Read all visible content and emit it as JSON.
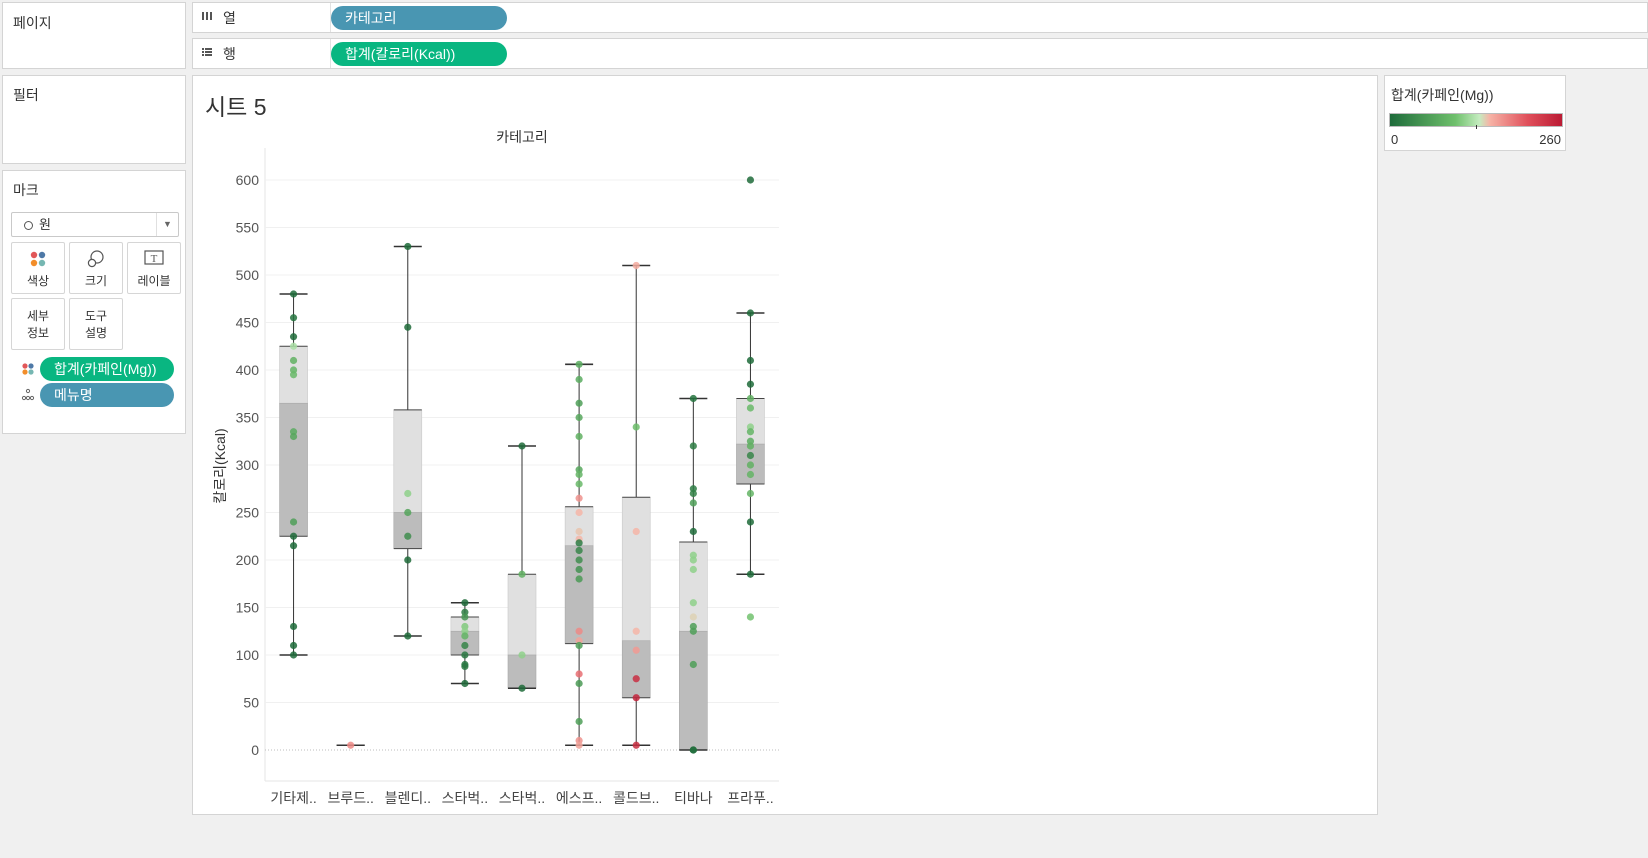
{
  "pages_card": {
    "title": "페이지"
  },
  "columns_shelf": {
    "label": "열",
    "icon": "columns-icon",
    "pill": "카테고리"
  },
  "rows_shelf": {
    "label": "행",
    "icon": "rows-icon",
    "pill": "합계(칼로리(Kcal))"
  },
  "filters_card": {
    "title": "필터"
  },
  "marks_card": {
    "title": "마크",
    "mark_type": "원",
    "buttons": {
      "color": "색상",
      "size": "크기",
      "label": "레이블",
      "detail_1": "세부",
      "detail_2": "정보",
      "tooltip_1": "도구",
      "tooltip_2": "설명"
    },
    "pills": {
      "color_pill": "합계(카페인(Mg))",
      "detail_pill": "메뉴명"
    }
  },
  "legend": {
    "title": "합계(카페인(Mg))",
    "min": "0",
    "max": "260"
  },
  "sheet": {
    "title": "시트 5"
  },
  "chart_data": {
    "type": "scatter",
    "subtype": "box-and-whisker with jittered points",
    "header": "카테고리",
    "ylabel": "칼로리(Kcal)",
    "ylim": [
      0,
      620
    ],
    "yticks": [
      0,
      50,
      100,
      150,
      200,
      250,
      300,
      350,
      400,
      450,
      500,
      550,
      600
    ],
    "grid": true,
    "color_measure": "합계(카페인(Mg))",
    "color_range": [
      0,
      260
    ],
    "colors": {
      "low": "#1e6b3a",
      "mid_low": "#8fd18b",
      "mid_high": "#f2a191",
      "high": "#bb1b34",
      "box_upper": "#e0e0e0",
      "box_lower": "#bcbcbc",
      "whisker": "#333333"
    },
    "categories": [
      "기타제..",
      "브루드..",
      "블렌디..",
      "스타벅..",
      "스타벅..",
      "에스프..",
      "콜드브..",
      "티바나",
      "프라푸.."
    ],
    "boxes": [
      {
        "category": "기타제..",
        "whisker_low": 100,
        "q1": 225,
        "median": 365,
        "q3": 425,
        "whisker_high": 480
      },
      {
        "category": "브루드..",
        "whisker_low": 5,
        "q1": 5,
        "median": 5,
        "q3": 5,
        "whisker_high": 5
      },
      {
        "category": "블렌디..",
        "whisker_low": 120,
        "q1": 212,
        "median": 250,
        "q3": 358,
        "whisker_high": 530
      },
      {
        "category": "스타벅..",
        "whisker_low": 70,
        "q1": 100,
        "median": 125,
        "q3": 140,
        "whisker_high": 155
      },
      {
        "category": "스타벅..",
        "whisker_low": 65,
        "q1": 65,
        "median": 100,
        "q3": 185,
        "whisker_high": 320
      },
      {
        "category": "에스프..",
        "whisker_low": 5,
        "q1": 112,
        "median": 215,
        "q3": 256,
        "whisker_high": 406
      },
      {
        "category": "콜드브..",
        "whisker_low": 5,
        "q1": 55,
        "median": 115,
        "q3": 266,
        "whisker_high": 510
      },
      {
        "category": "티바나",
        "whisker_low": 0,
        "q1": 0,
        "median": 125,
        "q3": 219,
        "whisker_high": 370
      },
      {
        "category": "프라푸..",
        "whisker_low": 185,
        "q1": 280,
        "median": 322,
        "q3": 370,
        "whisker_high": 460
      }
    ],
    "points": [
      {
        "category": "기타제..",
        "values": [
          {
            "y": 480,
            "c": 0
          },
          {
            "y": 455,
            "c": 10
          },
          {
            "y": 435,
            "c": 0
          },
          {
            "y": 425,
            "c": 120
          },
          {
            "y": 410,
            "c": 80
          },
          {
            "y": 400,
            "c": 85
          },
          {
            "y": 395,
            "c": 90
          },
          {
            "y": 335,
            "c": 75
          },
          {
            "y": 330,
            "c": 70
          },
          {
            "y": 240,
            "c": 60
          },
          {
            "y": 225,
            "c": 0
          },
          {
            "y": 215,
            "c": 0
          },
          {
            "y": 130,
            "c": 0
          },
          {
            "y": 110,
            "c": 0
          },
          {
            "y": 100,
            "c": 0
          }
        ]
      },
      {
        "category": "브루드..",
        "values": [
          {
            "y": 5,
            "c": 175
          }
        ]
      },
      {
        "category": "블렌디..",
        "values": [
          {
            "y": 530,
            "c": 0
          },
          {
            "y": 445,
            "c": 0
          },
          {
            "y": 270,
            "c": 110
          },
          {
            "y": 250,
            "c": 65
          },
          {
            "y": 225,
            "c": 40
          },
          {
            "y": 200,
            "c": 0
          },
          {
            "y": 120,
            "c": 0
          }
        ]
      },
      {
        "category": "스타벅..",
        "values": [
          {
            "y": 155,
            "c": 0
          },
          {
            "y": 145,
            "c": 20
          },
          {
            "y": 140,
            "c": 50
          },
          {
            "y": 130,
            "c": 105
          },
          {
            "y": 125,
            "c": 110
          },
          {
            "y": 120,
            "c": 85
          },
          {
            "y": 110,
            "c": 30
          },
          {
            "y": 100,
            "c": 15
          },
          {
            "y": 90,
            "c": 10
          },
          {
            "y": 88,
            "c": 15
          },
          {
            "y": 70,
            "c": 0
          }
        ]
      },
      {
        "category": "스타벅..",
        "values": [
          {
            "y": 320,
            "c": 0
          },
          {
            "y": 185,
            "c": 80
          },
          {
            "y": 100,
            "c": 110
          },
          {
            "y": 65,
            "c": 0
          }
        ]
      },
      {
        "category": "에스프..",
        "values": [
          {
            "y": 406,
            "c": 75
          },
          {
            "y": 390,
            "c": 75
          },
          {
            "y": 365,
            "c": 60
          },
          {
            "y": 350,
            "c": 70
          },
          {
            "y": 330,
            "c": 80
          },
          {
            "y": 295,
            "c": 70
          },
          {
            "y": 290,
            "c": 85
          },
          {
            "y": 280,
            "c": 90
          },
          {
            "y": 265,
            "c": 170
          },
          {
            "y": 250,
            "c": 150
          },
          {
            "y": 230,
            "c": 145
          },
          {
            "y": 222,
            "c": 150
          },
          {
            "y": 218,
            "c": 20
          },
          {
            "y": 210,
            "c": 30
          },
          {
            "y": 200,
            "c": 40
          },
          {
            "y": 190,
            "c": 45
          },
          {
            "y": 180,
            "c": 55
          },
          {
            "y": 125,
            "c": 175
          },
          {
            "y": 115,
            "c": 160
          },
          {
            "y": 110,
            "c": 60
          },
          {
            "y": 80,
            "c": 190
          },
          {
            "y": 70,
            "c": 55
          },
          {
            "y": 30,
            "c": 60
          },
          {
            "y": 10,
            "c": 170
          },
          {
            "y": 5,
            "c": 160
          }
        ]
      },
      {
        "category": "콜드브..",
        "values": [
          {
            "y": 510,
            "c": 155
          },
          {
            "y": 340,
            "c": 95
          },
          {
            "y": 230,
            "c": 150
          },
          {
            "y": 125,
            "c": 150
          },
          {
            "y": 105,
            "c": 165
          },
          {
            "y": 75,
            "c": 240
          },
          {
            "y": 55,
            "c": 250
          },
          {
            "y": 5,
            "c": 240
          }
        ]
      },
      {
        "category": "티바나",
        "values": [
          {
            "y": 370,
            "c": 10
          },
          {
            "y": 320,
            "c": 20
          },
          {
            "y": 275,
            "c": 20
          },
          {
            "y": 270,
            "c": 25
          },
          {
            "y": 260,
            "c": 60
          },
          {
            "y": 230,
            "c": 0
          },
          {
            "y": 205,
            "c": 110
          },
          {
            "y": 200,
            "c": 110
          },
          {
            "y": 190,
            "c": 110
          },
          {
            "y": 155,
            "c": 110
          },
          {
            "y": 140,
            "c": 140
          },
          {
            "y": 130,
            "c": 60
          },
          {
            "y": 125,
            "c": 60
          },
          {
            "y": 90,
            "c": 60
          },
          {
            "y": 0,
            "c": 0
          },
          {
            "y": 0,
            "c": 5
          }
        ]
      },
      {
        "category": "프라푸..",
        "values": [
          {
            "y": 600,
            "c": 0
          },
          {
            "y": 460,
            "c": 0
          },
          {
            "y": 410,
            "c": 0
          },
          {
            "y": 385,
            "c": 0
          },
          {
            "y": 370,
            "c": 80
          },
          {
            "y": 360,
            "c": 90
          },
          {
            "y": 340,
            "c": 110
          },
          {
            "y": 335,
            "c": 85
          },
          {
            "y": 325,
            "c": 75
          },
          {
            "y": 320,
            "c": 80
          },
          {
            "y": 310,
            "c": 30
          },
          {
            "y": 300,
            "c": 80
          },
          {
            "y": 290,
            "c": 85
          },
          {
            "y": 270,
            "c": 85
          },
          {
            "y": 240,
            "c": 0
          },
          {
            "y": 185,
            "c": 0
          },
          {
            "y": 140,
            "c": 100
          }
        ]
      }
    ]
  }
}
